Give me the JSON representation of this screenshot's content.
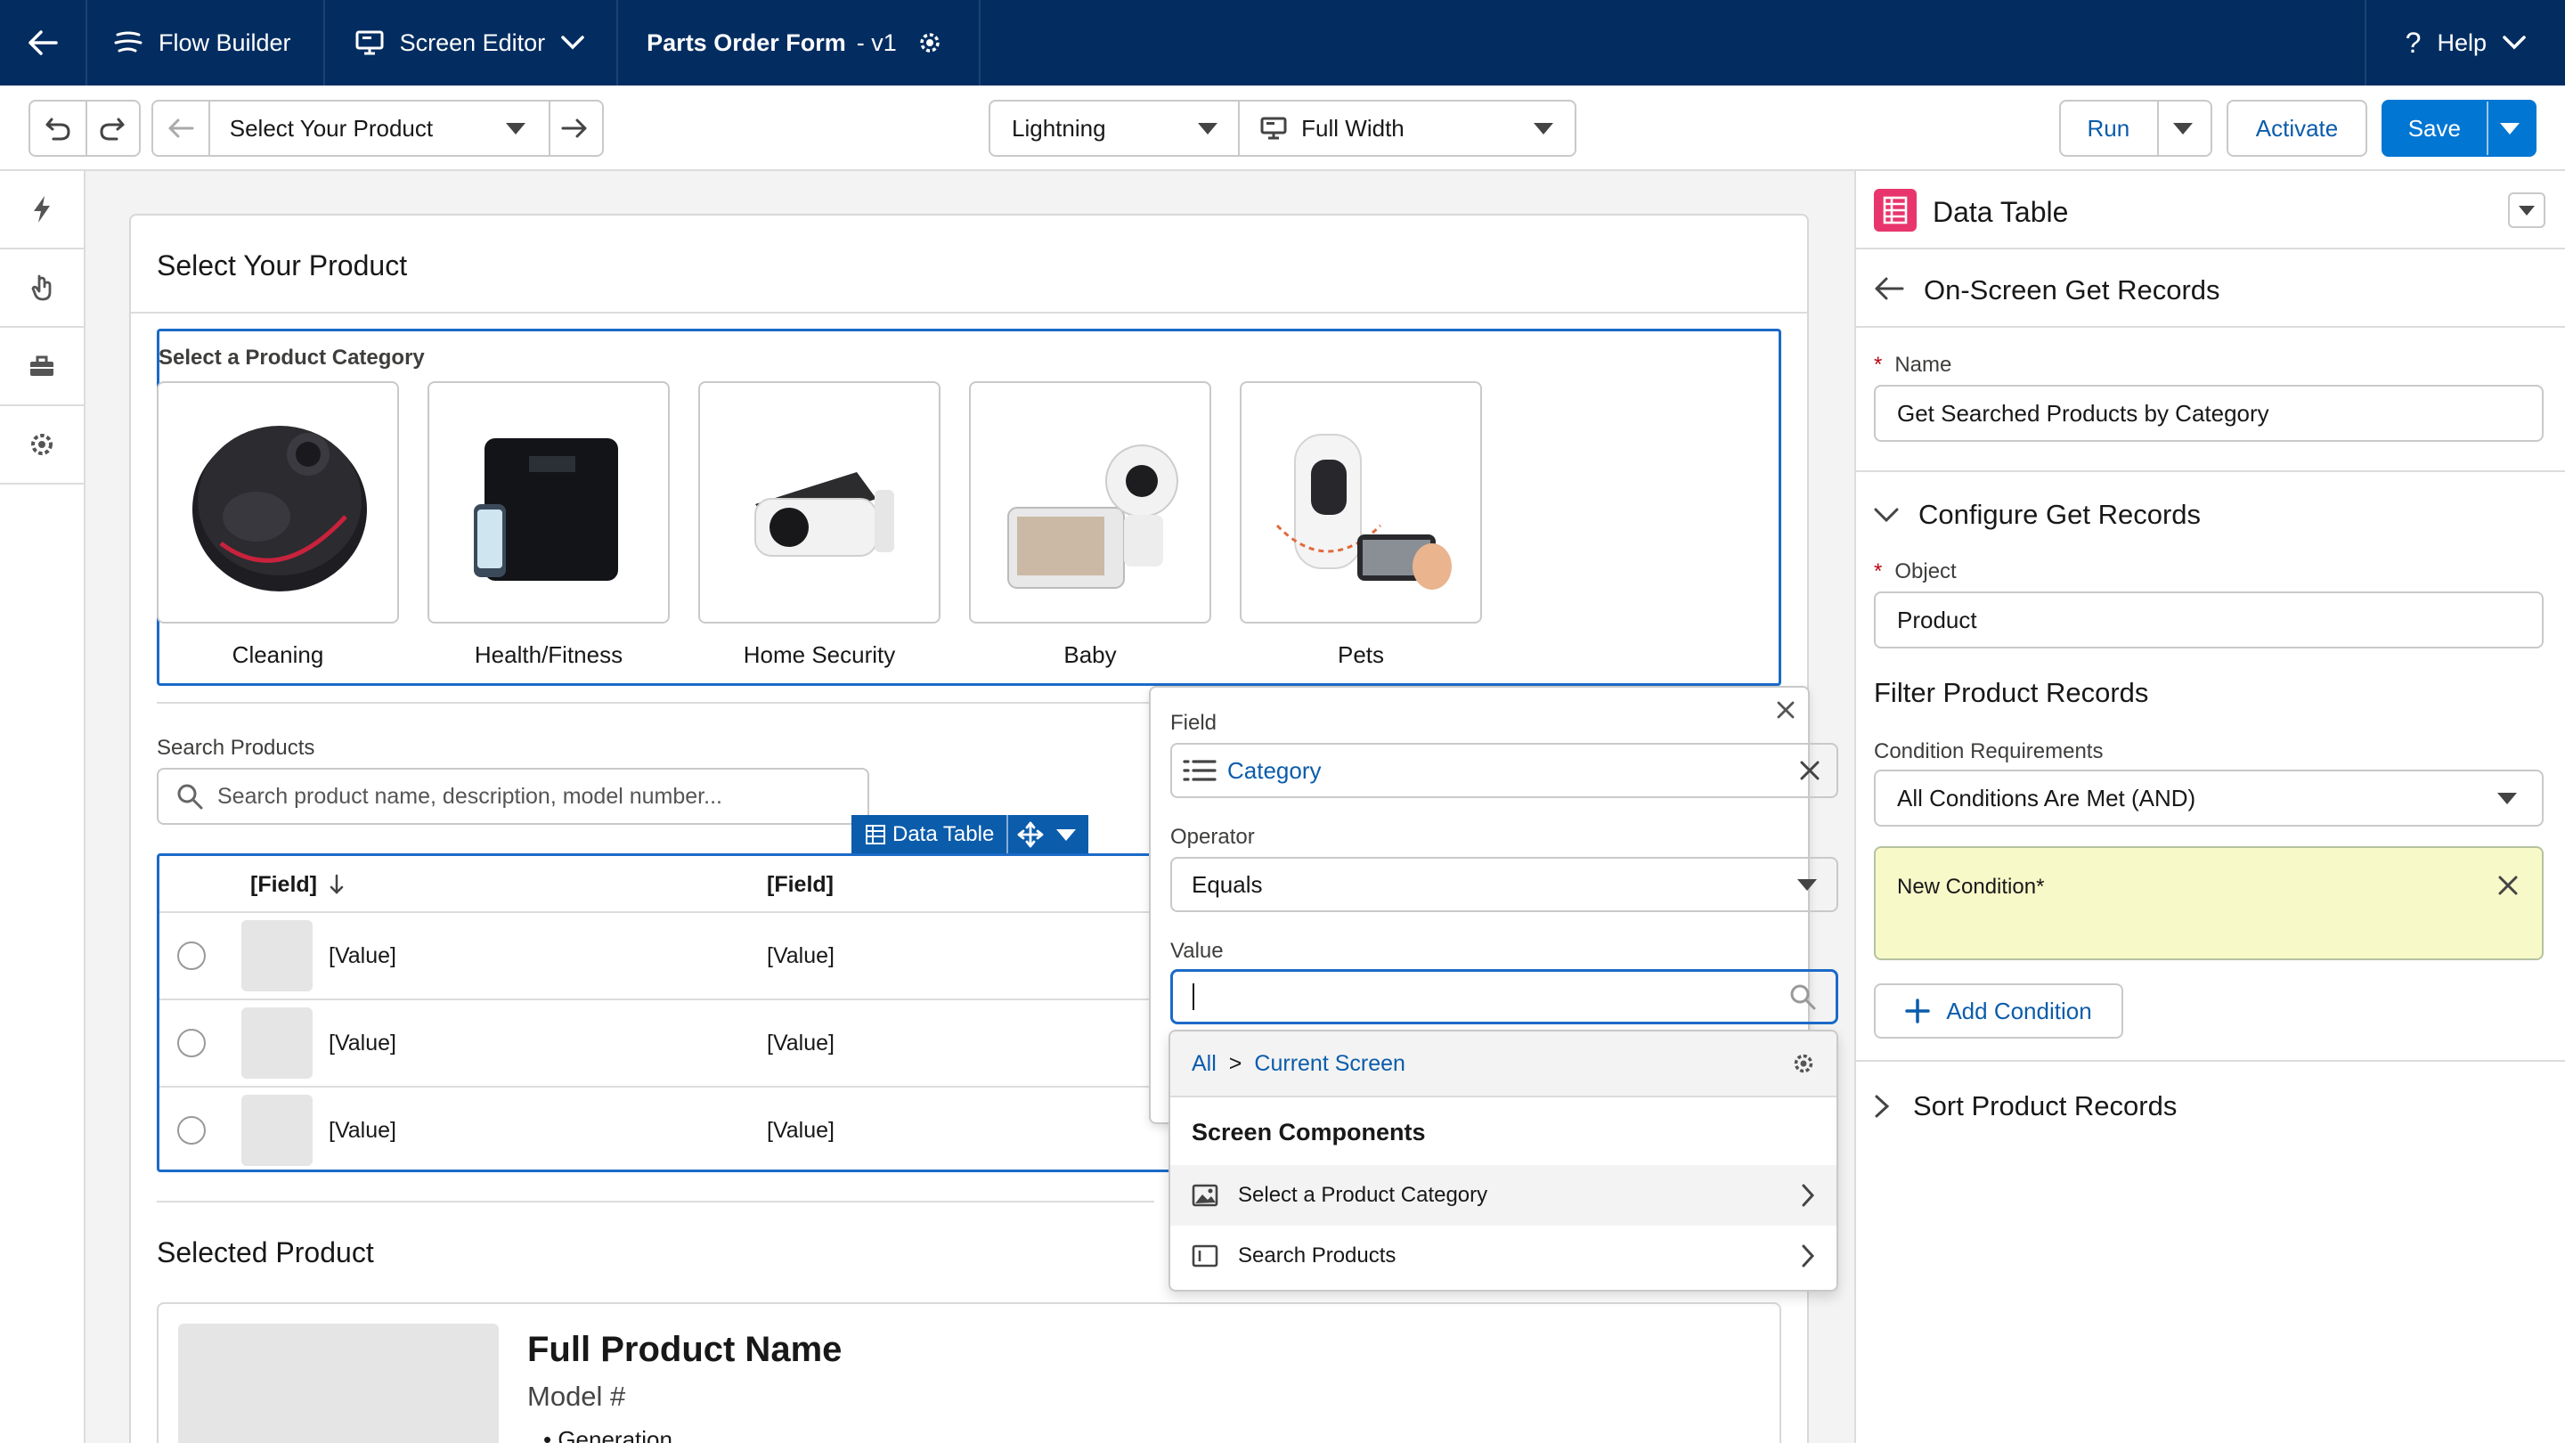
{
  "topnav": {
    "flow_builder": "Flow Builder",
    "screen_editor": "Screen Editor",
    "flow_title": "Parts Order Form",
    "flow_version": "- v1",
    "help": "Help"
  },
  "toolbar": {
    "screen_select": "Select Your Product",
    "theme_select": "Lightning",
    "width_select": "Full Width",
    "run": "Run",
    "activate": "Activate",
    "save": "Save"
  },
  "canvas": {
    "screen_title": "Select Your Product",
    "category_label": "Select a Product Category",
    "categories": [
      {
        "label": "Cleaning"
      },
      {
        "label": "Health/Fitness"
      },
      {
        "label": "Home Security"
      },
      {
        "label": "Baby"
      },
      {
        "label": "Pets"
      }
    ],
    "search_label": "Search Products",
    "search_placeholder": "Search product name, description, model number...",
    "data_table_tag": "Data Table",
    "table": {
      "headers": [
        "[Field]",
        "[Field]"
      ],
      "rows": [
        [
          "[Value]",
          "[Value]"
        ],
        [
          "[Value]",
          "[Value]"
        ],
        [
          "[Value]",
          "[Value]"
        ]
      ]
    },
    "selected_label": "Selected Product",
    "product_name": "Full Product Name",
    "product_model": "Model #",
    "product_bullet": "Generation"
  },
  "popover": {
    "field_label": "Field",
    "field_value": "Category",
    "operator_label": "Operator",
    "operator_value": "Equals",
    "value_label": "Value",
    "value_input": "",
    "breadcrumb_all": "All",
    "breadcrumb_sep": ">",
    "breadcrumb_current": "Current Screen",
    "section_heading": "Screen Components",
    "items": [
      {
        "label": "Select a Product Category"
      },
      {
        "label": "Search Products"
      }
    ]
  },
  "panel": {
    "component_title": "Data Table",
    "section_title": "On-Screen Get Records",
    "name_label": "Name",
    "name_value": "Get Searched Products by Category",
    "configure_title": "Configure Get Records",
    "object_label": "Object",
    "object_value": "Product",
    "filter_title": "Filter Product Records",
    "condition_req_label": "Condition Requirements",
    "condition_req_value": "All Conditions Are Met (AND)",
    "new_condition": "New Condition*",
    "add_condition": "Add Condition",
    "sort_title": "Sort Product Records"
  },
  "colors": {
    "nav_bg": "#032d60",
    "brand": "#0176d3",
    "link": "#0b5cab",
    "focus": "#1b6ac9",
    "condition_bg": "#f7f9c8",
    "data_table_icon": "#e8356d"
  }
}
